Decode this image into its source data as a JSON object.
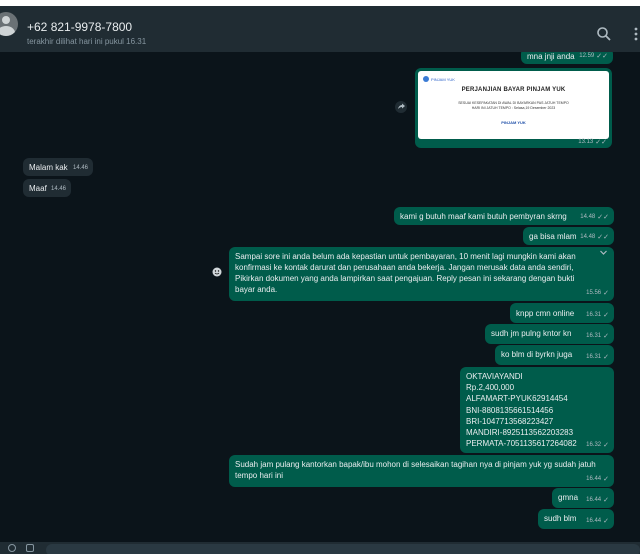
{
  "header": {
    "contact_name": "+62 821-9978-7800",
    "contact_status": "terakhir dilihat hari ini pukul 16.31",
    "icons": [
      "search-icon",
      "menu-icon"
    ]
  },
  "colors": {
    "chat_bg": "#0b141a",
    "header_bg": "#202c33",
    "outgoing_bubble": "#005c4b",
    "incoming_bubble": "#202c33"
  },
  "document_card": {
    "logo_text": "PINJAM YUK",
    "title": "PERJANJIAN BAYAR PINJAM YUK",
    "line1": "SESUAI KESEPAKATAN DI AWAL DI BAYARKAN PAS JATUH TEMPO",
    "line2": "HARI INI JATUH TEMPO : Selasa,19 Desember 2023",
    "brand": "PINJAM YUK",
    "time": "13.13"
  },
  "messages": [
    {
      "dir": "out",
      "text": "mna jnji anda",
      "time": "12.59"
    },
    {
      "dir": "in",
      "text": "Malam kak",
      "time": "14.46"
    },
    {
      "dir": "in",
      "text": "Maaf",
      "time": "14.46"
    },
    {
      "dir": "out",
      "text": "kami g butuh maaf kami butuh pembyran skrng",
      "time": "14.48"
    },
    {
      "dir": "out",
      "text": "ga bisa mlam",
      "time": "14.48"
    },
    {
      "dir": "out",
      "text": "Sampai sore ini anda belum ada kepastian untuk pembayaran, 10 menit lagi mungkin kami akan konfirmasi ke kontak darurat dan perusahaan anda bekerja. Jangan merusak data anda sendiri, Pikirkan dokumen yang anda lampirkan saat pengajuan. Reply pesan ini sekarang dengan bukti bayar anda.",
      "time": "15.56"
    },
    {
      "dir": "out",
      "text": "knpp cmn online",
      "time": "16.31"
    },
    {
      "dir": "out",
      "text": "sudh jm pulng kntor kn",
      "time": "16.31"
    },
    {
      "dir": "out",
      "text": "ko blm di byrkn juga",
      "time": "16.31"
    },
    {
      "dir": "out",
      "lines": [
        "OKTAVIAYANDI",
        "Rp.2,400,000",
        "ALFAMART-PYUK62914454",
        "BNI-8808135661514456",
        "BRI-1047713568223427",
        "MANDIRI-8925113562203283",
        "PERMATA-7051135617264082"
      ],
      "time": "16.32"
    },
    {
      "dir": "out",
      "text": "Sudah jam pulang kantorkan bapak/ibu mohon di selesaikan tagihan nya di pinjam yuk yg sudah jatuh tempo hari ini",
      "time": "16.44"
    },
    {
      "dir": "out",
      "text": "gmna",
      "time": "16.44"
    },
    {
      "dir": "out",
      "text": "sudh blm",
      "time": "16.44"
    }
  ]
}
